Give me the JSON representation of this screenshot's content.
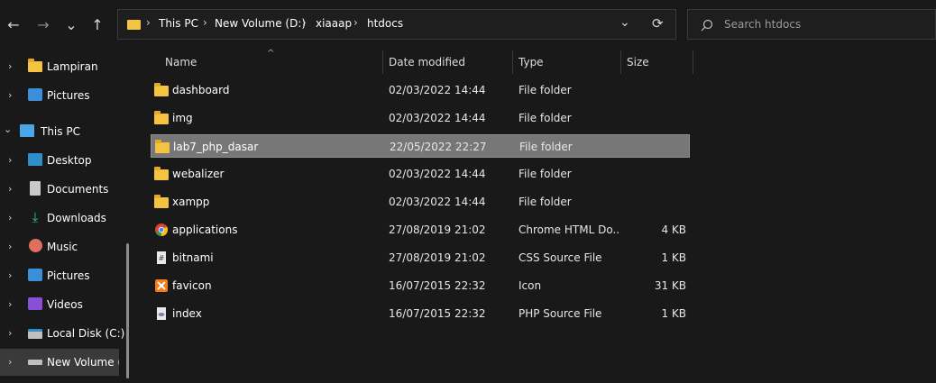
{
  "toolbar": {
    "back": "←",
    "forward": "→",
    "recent": "⌄",
    "up": "↑"
  },
  "address": {
    "crumbs": [
      "This PC",
      "New Volume (D:)",
      "xiaaap",
      "htdocs"
    ],
    "dropdown": "⌄",
    "refresh": "⟳"
  },
  "search": {
    "placeholder": "Search htdocs"
  },
  "sidebar": {
    "items": [
      {
        "label": "Lampiran",
        "icon": "folder-icon"
      },
      {
        "label": "Pictures",
        "icon": "pictures-icon"
      },
      {
        "label": "This PC",
        "icon": "computer-icon"
      },
      {
        "label": "Desktop",
        "icon": "desktop-icon"
      },
      {
        "label": "Documents",
        "icon": "documents-icon"
      },
      {
        "label": "Downloads",
        "icon": "downloads-icon"
      },
      {
        "label": "Music",
        "icon": "music-icon"
      },
      {
        "label": "Pictures",
        "icon": "pictures-icon"
      },
      {
        "label": "Videos",
        "icon": "videos-icon"
      },
      {
        "label": "Local Disk (C:)",
        "icon": "local-disk-icon"
      },
      {
        "label": "New Volume (D",
        "icon": "drive-icon"
      }
    ]
  },
  "columns": {
    "name": "Name",
    "date": "Date modified",
    "type": "Type",
    "size": "Size"
  },
  "files": [
    {
      "name": "dashboard",
      "date": "02/03/2022 14:44",
      "type": "File folder",
      "size": "",
      "icon": "folder-icon"
    },
    {
      "name": "img",
      "date": "02/03/2022 14:44",
      "type": "File folder",
      "size": "",
      "icon": "folder-icon"
    },
    {
      "name": "lab7_php_dasar",
      "date": "22/05/2022 22:27",
      "type": "File folder",
      "size": "",
      "icon": "folder-icon"
    },
    {
      "name": "webalizer",
      "date": "02/03/2022 14:44",
      "type": "File folder",
      "size": "",
      "icon": "folder-icon"
    },
    {
      "name": "xampp",
      "date": "02/03/2022 14:44",
      "type": "File folder",
      "size": "",
      "icon": "folder-icon"
    },
    {
      "name": "applications",
      "date": "27/08/2019 21:02",
      "type": "Chrome HTML Do...",
      "size": "4 KB",
      "icon": "chrome-icon"
    },
    {
      "name": "bitnami",
      "date": "27/08/2019 21:02",
      "type": "CSS Source File",
      "size": "1 KB",
      "icon": "css-file-icon"
    },
    {
      "name": "favicon",
      "date": "16/07/2015 22:32",
      "type": "Icon",
      "size": "31 KB",
      "icon": "xampp-icon"
    },
    {
      "name": "index",
      "date": "16/07/2015 22:32",
      "type": "PHP Source File",
      "size": "1 KB",
      "icon": "php-file-icon"
    }
  ]
}
